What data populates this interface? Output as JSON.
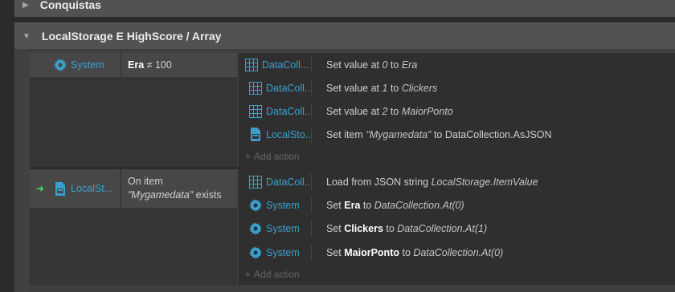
{
  "top_group": {
    "title": "Conquistas"
  },
  "main_group": {
    "title": "LocalStorage E HighScore / Array"
  },
  "icons": {
    "system": "gear-icon",
    "datacollection": "array-grid-icon",
    "localstorage": "storage-file-icon",
    "trigger": "trigger-arrow-icon"
  },
  "colors": {
    "object_name": "#3aa0cf",
    "header_bg": "#525252",
    "trigger_arrow": "#4cd964"
  },
  "event1": {
    "condition": {
      "object": "System",
      "prefix": "Era",
      "rest": " ≠ 100"
    },
    "actions": [
      {
        "object": "DataColl...",
        "pre": "Set value at ",
        "a": "0",
        "mid": " to ",
        "b": "Era"
      },
      {
        "object": "DataColl...",
        "pre": "Set value at ",
        "a": "1",
        "mid": " to ",
        "b": "Clickers"
      },
      {
        "object": "DataColl...",
        "pre": "Set value at ",
        "a": "2",
        "mid": " to ",
        "b": "MaiorPonto"
      },
      {
        "object": "LocalSto...",
        "pre": "Set item ",
        "a": "\"Mygamedata\"",
        "mid": " to DataCollection.AsJSON",
        "b": ""
      }
    ],
    "add_action": "Add action"
  },
  "event2": {
    "condition": {
      "object": "LocalSt...",
      "line1": "On item",
      "line2_italic": "\"Mygamedata\"",
      "line2_rest": " exists"
    },
    "actions": [
      {
        "object": "DataColl...",
        "pre": "Load from JSON string ",
        "bold": "",
        "post": "",
        "italic": "LocalStorage.ItemValue"
      },
      {
        "object": "System",
        "pre": "Set ",
        "bold": "Era",
        "post": " to ",
        "italic": "DataCollection.At(0)"
      },
      {
        "object": "System",
        "pre": "Set ",
        "bold": "Clickers",
        "post": " to ",
        "italic": "DataCollection.At(1)"
      },
      {
        "object": "System",
        "pre": "Set ",
        "bold": "MaiorPonto",
        "post": " to ",
        "italic": "DataCollection.At(0)"
      }
    ],
    "add_action": "Add action"
  }
}
